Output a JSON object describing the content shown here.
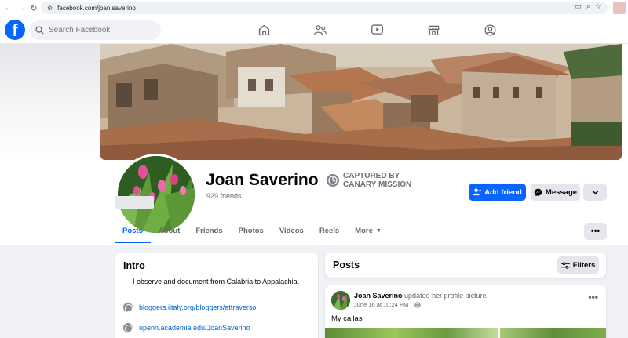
{
  "browser": {
    "url": "facebook.com/joan.saverino"
  },
  "header": {
    "logo": "f",
    "search_placeholder": "Search Facebook",
    "nav_icons": [
      "home-icon",
      "friends-icon",
      "watch-icon",
      "marketplace-icon",
      "groups-icon"
    ]
  },
  "profile": {
    "name": "Joan Saverino",
    "friends": "929 friends",
    "stamp_line1": "CAPTURED BY",
    "stamp_line2": "CANARY MISSION",
    "add_friend": "Add friend",
    "message": "Message"
  },
  "tabs": [
    {
      "label": "Posts",
      "active": true
    },
    {
      "label": "About",
      "active": false
    },
    {
      "label": "Friends",
      "active": false
    },
    {
      "label": "Photos",
      "active": false
    },
    {
      "label": "Videos",
      "active": false
    },
    {
      "label": "Reels",
      "active": false
    },
    {
      "label": "More",
      "active": false
    }
  ],
  "intro": {
    "title": "Intro",
    "bio": "I observe and document from Calabria to Appalachia.",
    "links": [
      "bloggers.iitaly.org/bloggers/attraverso",
      "upenn.academia.edu/JoanSaverino"
    ]
  },
  "posts": {
    "title": "Posts",
    "filters": "Filters",
    "post": {
      "author": "Joan Saverino",
      "action": "updated her profile picture.",
      "time": "June 16 at 10:24 PM ·",
      "text": "My callas"
    }
  },
  "colors": {
    "brand": "#0866ff",
    "secondary_button": "#e4e6eb",
    "background": "#f0f2f5"
  }
}
